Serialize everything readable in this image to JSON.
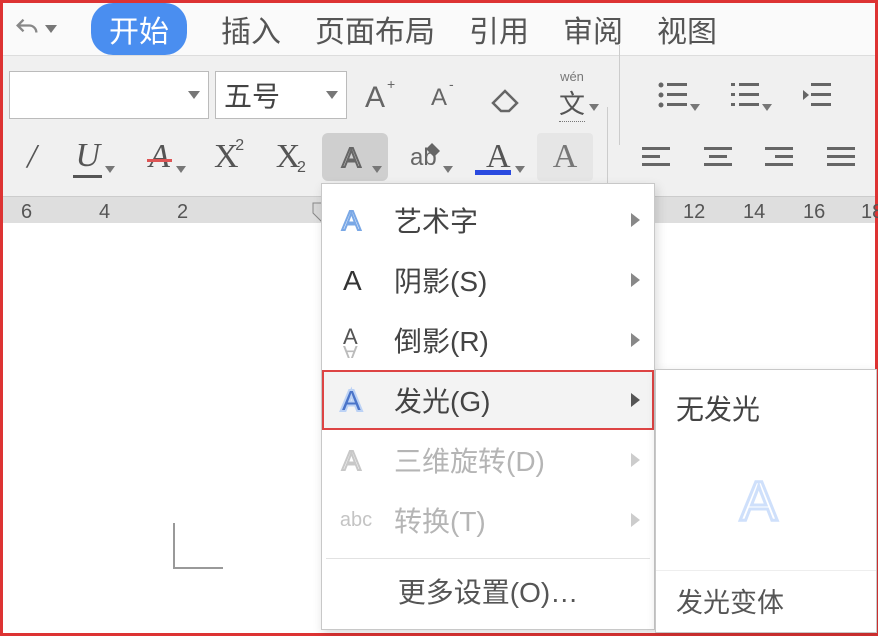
{
  "tabs": {
    "start": "开始",
    "insert": "插入",
    "layout": "页面布局",
    "reference": "引用",
    "review": "审阅",
    "view": "视图"
  },
  "ribbon": {
    "font_size_label": "五号",
    "wen_label": "wén",
    "wen_char": "文"
  },
  "ruler": {
    "t6": "6",
    "t4": "4",
    "t2": "2",
    "t12": "12",
    "t14": "14",
    "t16": "16",
    "t18": "18"
  },
  "menu": {
    "wordart": "艺术字",
    "shadow": "阴影(S)",
    "reflection": "倒影(R)",
    "glow": "发光(G)",
    "rotate3d": "三维旋转(D)",
    "transform": "转换(T)",
    "transform_abc": "abc",
    "more": "更多设置(O)…"
  },
  "submenu": {
    "no_glow": "无发光",
    "glow_variants": "发光变体"
  }
}
